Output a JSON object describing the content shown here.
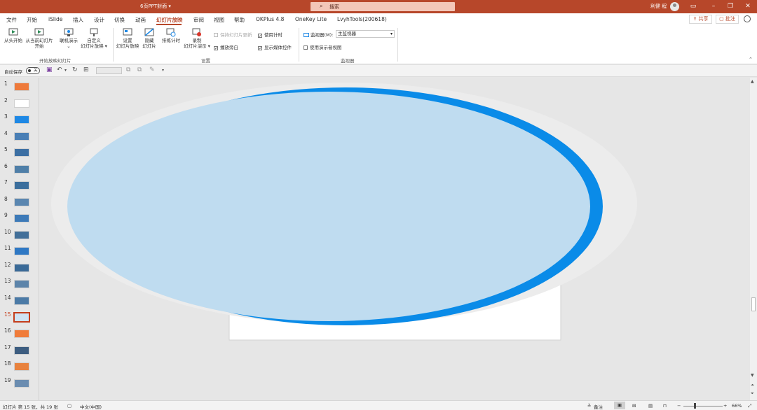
{
  "titlebar": {
    "doc_title": "6页PPT封面 ▾",
    "search_placeholder": "搜索",
    "user_name": "利健 程",
    "window_buttons": [
      "restore-ribbon-icon",
      "minimize-icon",
      "maximize-icon",
      "close-icon"
    ]
  },
  "tabs": [
    "文件",
    "开始",
    "iSlide",
    "插入",
    "设计",
    "切换",
    "动画",
    "幻灯片放映",
    "审阅",
    "视图",
    "帮助",
    "OKPlus 4.8",
    "OneKey Lite",
    "LvyhTools(200618)"
  ],
  "tab_active": "幻灯片放映",
  "share_label": "共享",
  "comment_label": "批注",
  "ribbon": {
    "groups": [
      "开始放映幻灯片",
      "设置",
      "监视器"
    ],
    "start_group": {
      "from_beginning": "从头开始",
      "from_current_l1": "从当前幻灯片",
      "from_current_l2": "开始",
      "online": "联机演示",
      "custom_l1": "自定义",
      "custom_l2": "幻灯片放映 ▾"
    },
    "setup_group": {
      "setup_l1": "设置",
      "setup_l2": "幻灯片放映",
      "hide_l1": "隐藏",
      "hide_l2": "幻灯片",
      "rehearse": "排练计时",
      "record_l1": "录制",
      "record_l2": "幻灯片演示 ▾",
      "keep_updated": "保持幻灯片更新",
      "play_narrations": "播放旁白",
      "use_timings": "使用计时",
      "show_media_controls": "显示媒体控件"
    },
    "monitor_group": {
      "monitor_label": "监视器(M):",
      "monitor_value": "主监视器",
      "presenter_view": "使用演示者视图"
    }
  },
  "qat": {
    "autosave_label": "自动保存",
    "autosave_state": "关"
  },
  "slides": {
    "numbers": [
      "1",
      "2",
      "3",
      "4",
      "5",
      "6",
      "7",
      "8",
      "9",
      "10",
      "11",
      "12",
      "13",
      "14",
      "15",
      "16",
      "17",
      "18",
      "19"
    ],
    "active": "15",
    "thumb_colors": [
      "#ee7a3b",
      "#ffffff",
      "#1e88e5",
      "#4a7fb5",
      "#3c6fa3",
      "#4f7fa8",
      "#3b6e9c",
      "#5a86b0",
      "#3d7ab8",
      "#426f99",
      "#2f78c4",
      "#3a6a97",
      "#5c84aa",
      "#4b7aa6",
      "#cfe3f3",
      "#f07c3a",
      "#3d5d80",
      "#e8823e",
      "#6a8cb0"
    ]
  },
  "slide_canvas": {
    "ellipse_fill": "#bfdcf0",
    "ellipse_edge": "#0a8be8",
    "halo": "#ececec",
    "page": "#ffffff"
  },
  "statusbar": {
    "slide_info": "幻灯片 第 15 张，共 19 张",
    "language": "中文(中国)",
    "notes": "备注",
    "zoom": "66%"
  }
}
